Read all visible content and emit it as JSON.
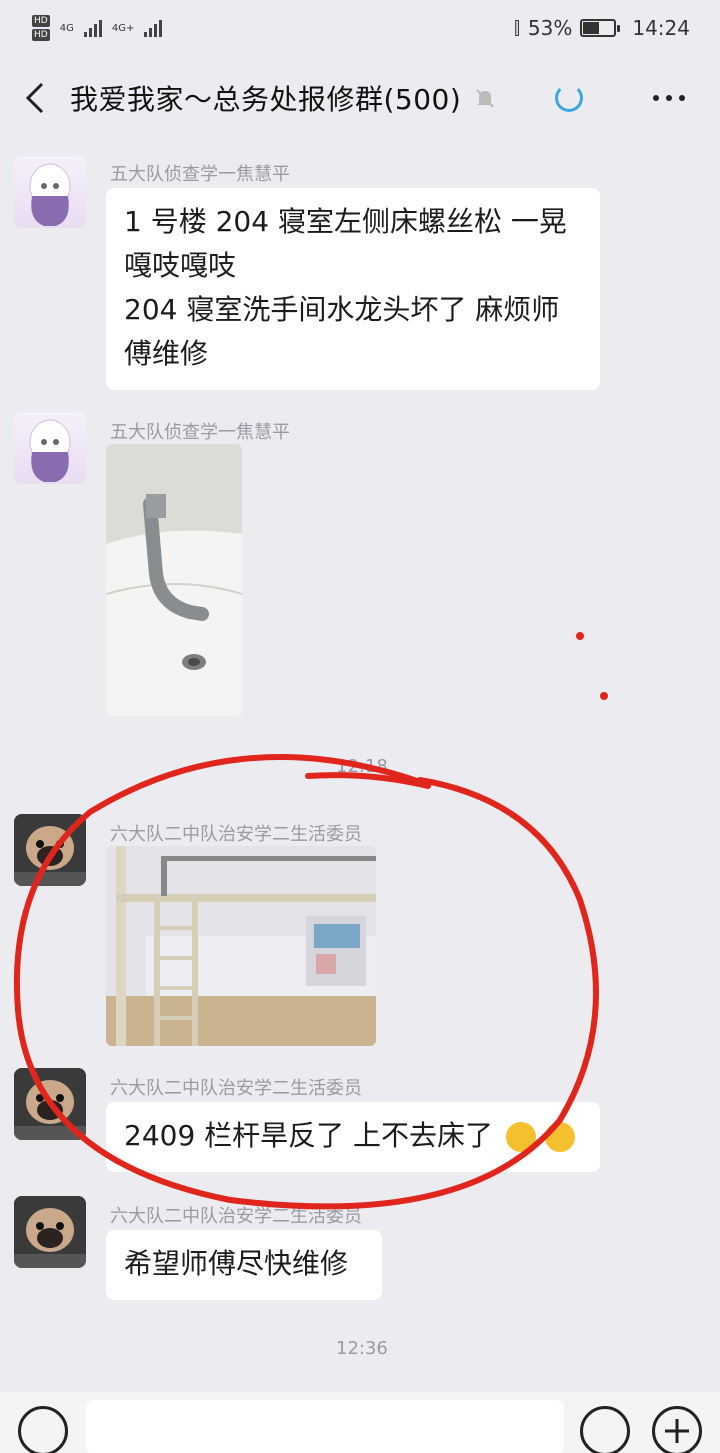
{
  "status_bar": {
    "network1": "4G",
    "network2": "4G+",
    "battery_text": "53%",
    "battery_level": 0.53,
    "time": "14:24"
  },
  "header": {
    "back_icon": "chevron-left-icon",
    "title": "我爱我家～总务处报修群(500)",
    "mute_icon": "muted-bell-icon",
    "more_icon": "more-dots-icon"
  },
  "messages": [
    {
      "sender": "五大队侦查学一焦慧平",
      "lines": [
        "1 号楼 204 寝室左侧床螺丝松 一晃",
        "嘎吱嘎吱",
        "204 寝室洗手间水龙头坏了 麻烦师",
        "傅维修"
      ]
    },
    {
      "sender": "五大队侦查学一焦慧平",
      "image": "sink-faucet-photo"
    },
    {
      "time": "12:18"
    },
    {
      "sender": "六大队二中队治安学二生活委员",
      "image": "bunk-bed-photo"
    },
    {
      "sender": "六大队二中队治安学二生活委员",
      "text": "2409 栏杆旱反了 上不去床了"
    },
    {
      "sender": "六大队二中队治安学二生活委员",
      "text": "希望师傅尽快维修"
    },
    {
      "time": "12:36"
    }
  ],
  "input_bar": {
    "voice_icon": "voice-icon",
    "emoji_icon": "emoji-icon",
    "plus_icon": "plus-icon"
  },
  "colors": {
    "background": "#ececf0",
    "bubble": "#ffffff",
    "annotation_red": "#e0261c",
    "loading_blue": "#3aa7e0"
  }
}
